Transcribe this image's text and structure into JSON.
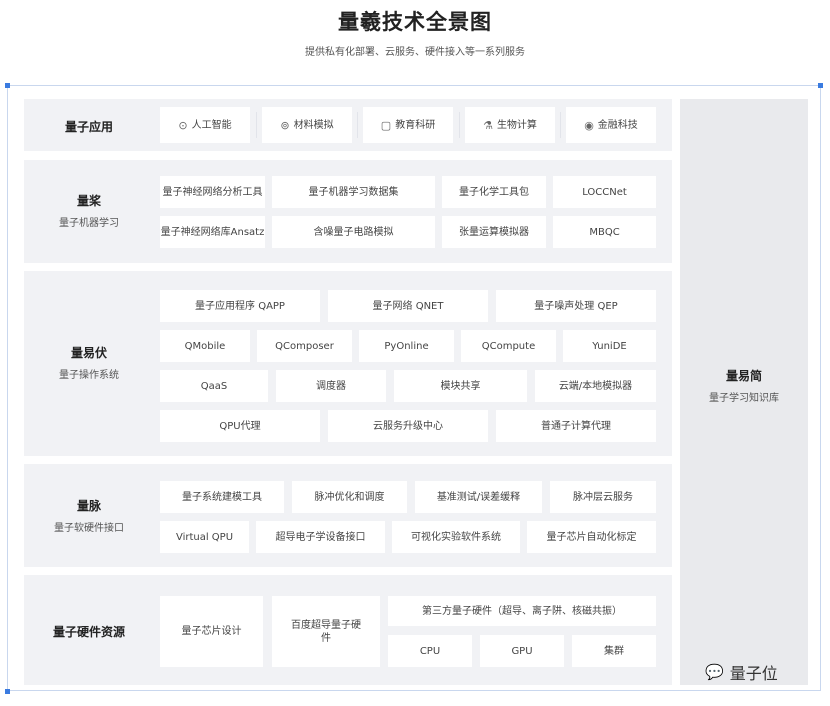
{
  "header": {
    "title": "量羲技术全景图",
    "subtitle": "提供私有化部署、云服务、硬件接入等一系列服务"
  },
  "rows": {
    "apps": {
      "label": "量子应用",
      "items": [
        {
          "icon": "⊙",
          "icon_name": "ai-icon",
          "label": "人工智能"
        },
        {
          "icon": "⊚",
          "icon_name": "material-icon",
          "label": "材料模拟"
        },
        {
          "icon": "▢",
          "icon_name": "book-icon",
          "label": "教育科研"
        },
        {
          "icon": "⚗",
          "icon_name": "flask-icon",
          "label": "生物计算"
        },
        {
          "icon": "◉",
          "icon_name": "finance-icon",
          "label": "金融科技"
        }
      ]
    },
    "paddle": {
      "label": "量桨",
      "sublabel": "量子机器学习",
      "items": [
        "量子神经网络分析工具",
        "量子机器学习数据集",
        "量子化学工具包",
        "LOCCNet",
        "量子神经网络库Ansatz",
        "含噪量子电路模拟",
        "张量运算模拟器",
        "MBQC"
      ]
    },
    "yifu": {
      "label": "量易伏",
      "sublabel": "量子操作系统",
      "items": [
        "量子应用程序 QAPP",
        "量子网络 QNET",
        "量子噪声处理 QEP",
        "QMobile",
        "QComposer",
        "PyOnline",
        "QCompute",
        "YuniDE",
        "QaaS",
        "调度器",
        "模块共享",
        "云端/本地模拟器",
        "QPU代理",
        "云服务升级中心",
        "普通子计算代理"
      ]
    },
    "mai": {
      "label": "量脉",
      "sublabel": "量子软硬件接口",
      "items": [
        "量子系统建模工具",
        "脉冲优化和调度",
        "基准测试/误差缓释",
        "脉冲层云服务",
        "Virtual QPU",
        "超导电子学设备接口",
        "可视化实验软件系统",
        "量子芯片自动化标定"
      ]
    },
    "hardware": {
      "label": "量子硬件资源",
      "chip": "量子芯片设计",
      "baidu": "百度超导量子硬件",
      "third_party": "第三方量子硬件（超导、离子阱、核磁共振）",
      "items": [
        "CPU",
        "GPU",
        "集群"
      ]
    }
  },
  "side": {
    "label": "量易简",
    "sublabel": "量子学习知识库"
  },
  "watermark": {
    "icon_name": "wechat-icon",
    "label": "量子位"
  },
  "colors": {
    "row_bg": "#f1f2f5",
    "box_bg": "#ffffff",
    "side_bg": "#e9eaed",
    "frame_border": "#c9d7ee",
    "handle": "#3a7be0"
  }
}
